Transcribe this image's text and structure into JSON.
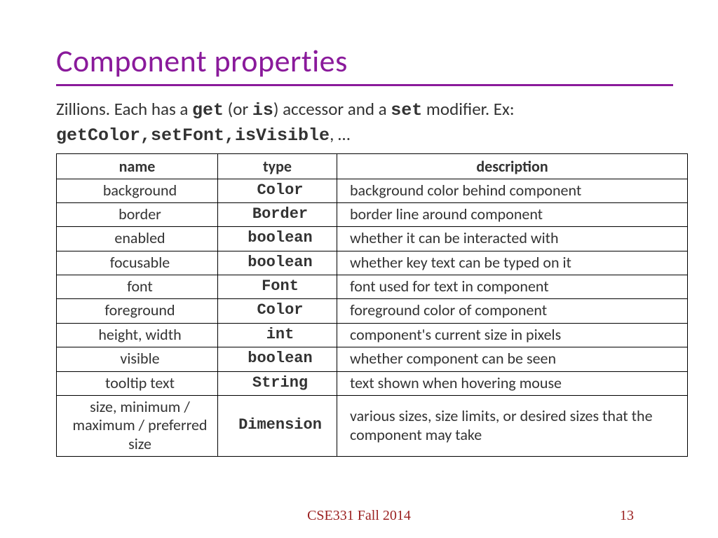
{
  "title": "Component properties",
  "intro": {
    "p1a": "Zillions.  Each has a ",
    "get": "get",
    "p1b": " (or ",
    "is": "is",
    "p1c": ") accessor and a ",
    "set": "set",
    "p1d": " modifier. Ex:",
    "ex": "getColor,setFont,isVisible",
    "p2tail": ", …"
  },
  "table": {
    "headers": {
      "name": "name",
      "type": "type",
      "description": "description"
    },
    "rows": [
      {
        "name": "background",
        "type": "Color",
        "description": "background color behind component"
      },
      {
        "name": "border",
        "type": "Border",
        "description": "border line around component"
      },
      {
        "name": "enabled",
        "type": "boolean",
        "description": "whether it can be interacted with"
      },
      {
        "name": "focusable",
        "type": "boolean",
        "description": "whether key text can be typed on it"
      },
      {
        "name": "font",
        "type": "Font",
        "description": "font used for text in component"
      },
      {
        "name": "foreground",
        "type": "Color",
        "description": "foreground color of component"
      },
      {
        "name": "height, width",
        "type": "int",
        "description": "component's current size in pixels"
      },
      {
        "name": "visible",
        "type": "boolean",
        "description": "whether component can be seen"
      },
      {
        "name": "tooltip text",
        "type": "String",
        "description": "text shown when hovering mouse"
      },
      {
        "name": "size, minimum / maximum / preferred size",
        "type": "Dimension",
        "description": "various sizes, size limits, or desired sizes that the component may take",
        "small": true
      }
    ]
  },
  "footer": {
    "course": "CSE331 Fall 2014",
    "page": "13"
  }
}
